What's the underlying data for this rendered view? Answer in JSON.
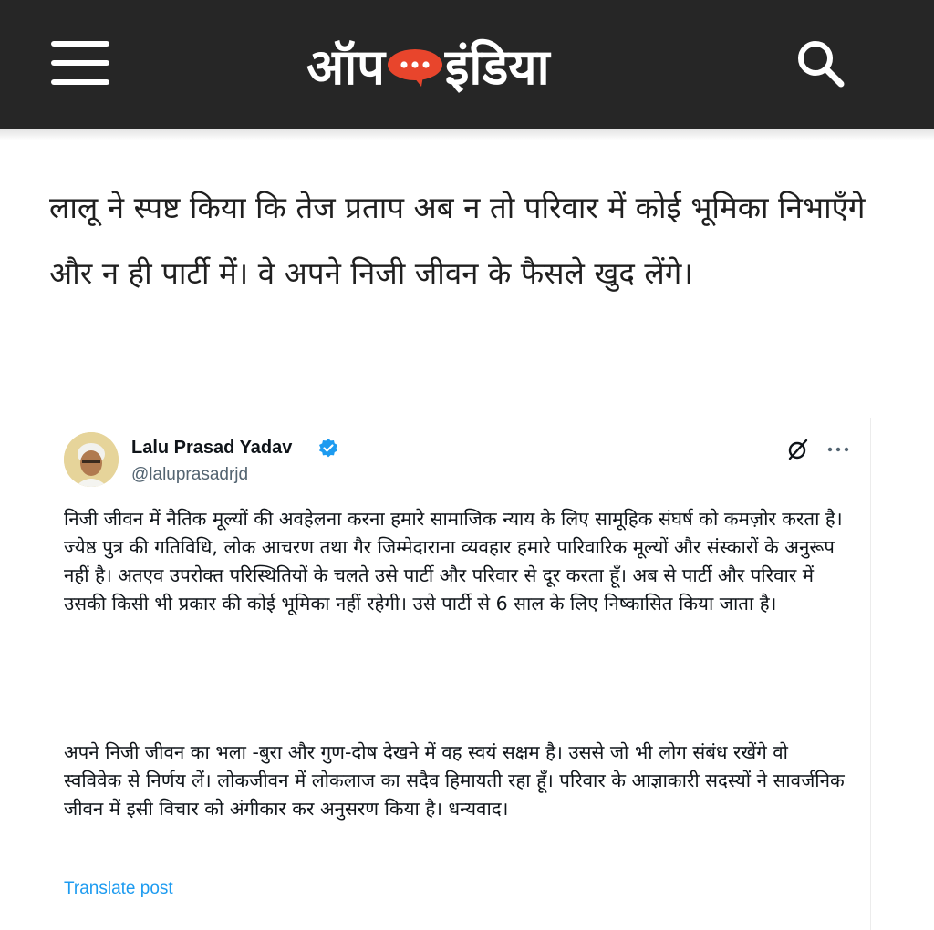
{
  "header": {
    "logo_text_left": "ऑप",
    "logo_text_right": "इंडिया",
    "menu_icon": "hamburger-menu-icon",
    "search_icon": "search-icon",
    "background": "#262626",
    "accent": "#e8452c"
  },
  "article": {
    "paragraph": "लालू ने स्पष्ट किया कि तेज प्रताप अब न तो परिवार में कोई भूमिका निभाएँगे और न ही पार्टी में। वे अपने निजी जीवन के फैसले खुद लेंगे।"
  },
  "tweet": {
    "author_name": "Lalu Prasad Yadav",
    "handle": "@laluprasadrjd",
    "verified": true,
    "paragraph_1": "निजी जीवन में नैतिक मूल्यों की अवहेलना करना हमारे सामाजिक न्याय के लिए सामूहिक संघर्ष को कमज़ोर करता है। ज्येष्ठ पुत्र की गतिविधि, लोक आचरण तथा गैर जिम्मेदाराना व्यवहार हमारे पारिवारिक मूल्यों और संस्कारों के अनुरूप नहीं है। अतएव उपरोक्त परिस्थितियों के चलते उसे पार्टी और परिवार से दूर करता हूँ। अब से पार्टी और परिवार में उसकी किसी भी प्रकार की कोई भूमिका नहीं रहेगी। उसे पार्टी से 6 साल के लिए निष्कासित किया जाता है।",
    "paragraph_2": "अपने निजी जीवन का भला -बुरा और गुण-दोष देखने में वह स्वयं सक्षम है। उससे जो भी लोग संबंध रखेंगे वो स्वविवेक से निर्णय लें। लोकजीवन में लोकलाज का सदैव हिमायती रहा हूँ। परिवार के आज्ञाकारी सदस्यों ने सावर्जनिक जीवन में इसी विचार को अंगीकार कर अनुसरण किया है। धन्यवाद।",
    "translate_label": "Translate post",
    "link_color": "#1d9bf0",
    "icons": [
      "grok-icon",
      "more-options-icon",
      "verified-badge-icon"
    ]
  }
}
